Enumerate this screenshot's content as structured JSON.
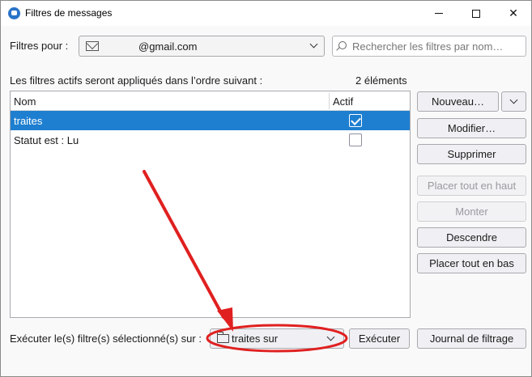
{
  "window": {
    "title": "Filtres de messages"
  },
  "filters_for": {
    "label": "Filtres pour :",
    "account": "@gmail.com"
  },
  "search": {
    "placeholder": "Rechercher les filtres par nom…"
  },
  "list_info": {
    "description": "Les filtres actifs seront appliqués dans l’ordre suivant :",
    "count": "2 éléments"
  },
  "table": {
    "columns": [
      "Nom",
      "Actif"
    ],
    "rows": [
      {
        "name": "traites",
        "active": true,
        "selected": true
      },
      {
        "name": "Statut est : Lu",
        "active": false,
        "selected": false
      }
    ]
  },
  "buttons": {
    "new": "Nouveau…",
    "modify": "Modifier…",
    "delete": "Supprimer",
    "move_top": "Placer tout en haut",
    "move_up": "Monter",
    "move_down": "Descendre",
    "move_bottom": "Placer tout en bas",
    "run": "Exécuter",
    "log": "Journal de filtrage"
  },
  "run_on": {
    "label": "Exécuter le(s) filtre(s) sélectionné(s) sur :",
    "folder": "traites sur"
  },
  "colors": {
    "selection": "#1e7fd0",
    "annotation": "#e02020"
  },
  "icons": {
    "app": "thunderbird-icon",
    "account": "mail-icon",
    "search": "search-icon",
    "folder": "folder-icon"
  }
}
